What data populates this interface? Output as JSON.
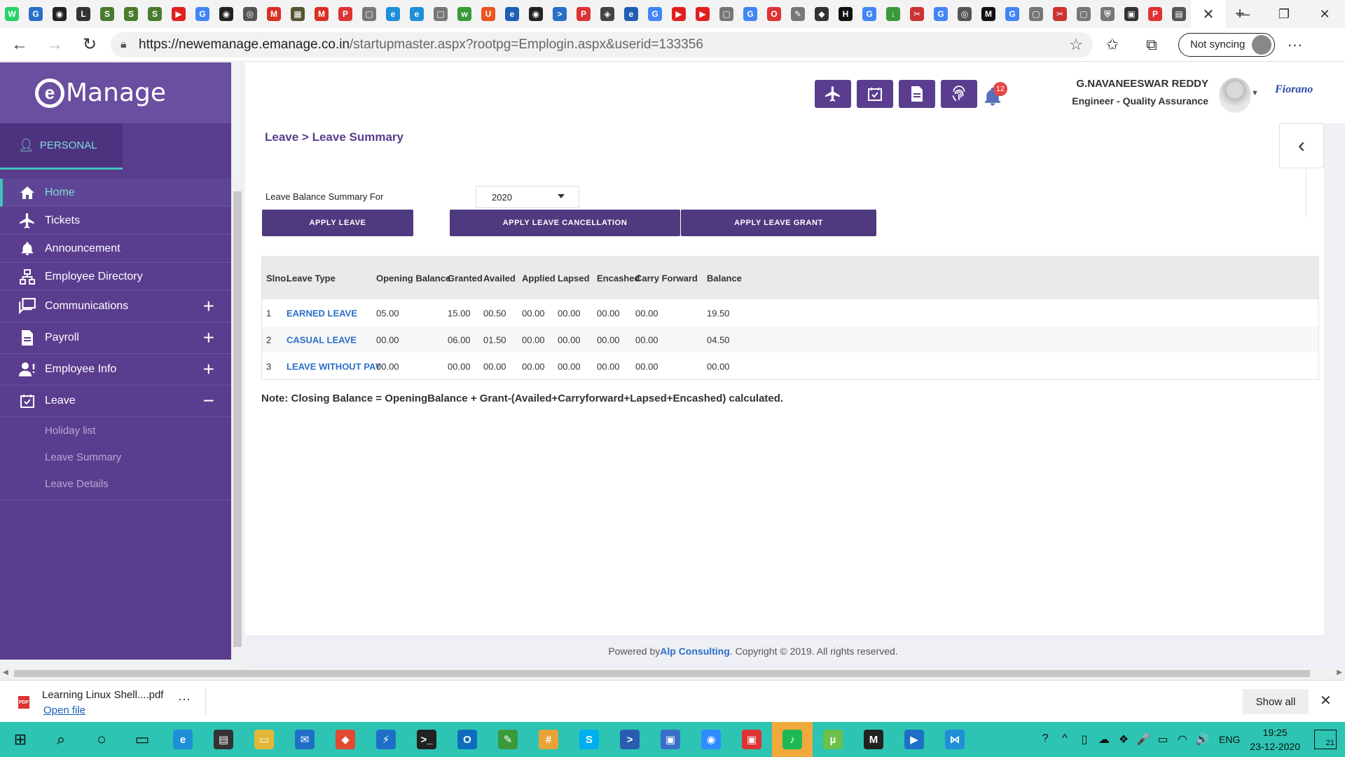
{
  "browser": {
    "tab_favicons": [
      {
        "icon": "whatsapp-icon",
        "glyph": "W",
        "color": "#25d366"
      },
      {
        "icon": "globe-icon",
        "glyph": "G",
        "color": "#2a6fc9"
      },
      {
        "icon": "github-icon",
        "glyph": "◉",
        "color": "#222"
      },
      {
        "icon": "linux-icon",
        "glyph": "L",
        "color": "#333"
      },
      {
        "icon": "sheets-icon",
        "glyph": "S",
        "color": "#4a7c2f"
      },
      {
        "icon": "sheets-icon",
        "glyph": "S",
        "color": "#4a7c2f"
      },
      {
        "icon": "sheets-icon",
        "glyph": "S",
        "color": "#4a7c2f"
      },
      {
        "icon": "youtube-icon",
        "glyph": "▶",
        "color": "#e02020"
      },
      {
        "icon": "google-icon",
        "glyph": "G",
        "color": "#4285f4"
      },
      {
        "icon": "github-icon",
        "glyph": "◉",
        "color": "#222"
      },
      {
        "icon": "globe-icon",
        "glyph": "◎",
        "color": "#555"
      },
      {
        "icon": "gmail-icon",
        "glyph": "M",
        "color": "#d93025"
      },
      {
        "icon": "image-icon",
        "glyph": "▦",
        "color": "#553"
      },
      {
        "icon": "gmail-icon",
        "glyph": "M",
        "color": "#d93025"
      },
      {
        "icon": "pdf-icon",
        "glyph": "P",
        "color": "#d33"
      },
      {
        "icon": "page-icon",
        "glyph": "▢",
        "color": "#777"
      },
      {
        "icon": "edge-icon",
        "glyph": "e",
        "color": "#1f8fd8"
      },
      {
        "icon": "edge-icon",
        "glyph": "e",
        "color": "#1f8fd8"
      },
      {
        "icon": "page-icon",
        "glyph": "▢",
        "color": "#777"
      },
      {
        "icon": "w3-icon",
        "glyph": "w",
        "color": "#3a9a3a"
      },
      {
        "icon": "ubuntu-icon",
        "glyph": "U",
        "color": "#e95420"
      },
      {
        "icon": "edureka-icon",
        "glyph": "e",
        "color": "#1f5fb4"
      },
      {
        "icon": "github-icon",
        "glyph": "◉",
        "color": "#222"
      },
      {
        "icon": "terminal-icon",
        "glyph": ">",
        "color": "#2a6fc9"
      },
      {
        "icon": "pdf-icon",
        "glyph": "P",
        "color": "#d33"
      },
      {
        "icon": "settings-icon",
        "glyph": "◈",
        "color": "#444"
      },
      {
        "icon": "edureka-icon",
        "glyph": "e",
        "color": "#1f5fb4"
      },
      {
        "icon": "google-icon",
        "glyph": "G",
        "color": "#4285f4"
      },
      {
        "icon": "youtube-icon",
        "glyph": "▶",
        "color": "#e02020"
      },
      {
        "icon": "youtube-icon",
        "glyph": "▶",
        "color": "#e02020"
      },
      {
        "icon": "page-icon",
        "glyph": "▢",
        "color": "#777"
      },
      {
        "icon": "google-icon",
        "glyph": "G",
        "color": "#4285f4"
      },
      {
        "icon": "os-icon",
        "glyph": "O",
        "color": "#d33"
      },
      {
        "icon": "tool-icon",
        "glyph": "✎",
        "color": "#777"
      },
      {
        "icon": "bookmark-icon",
        "glyph": "◆",
        "color": "#333"
      },
      {
        "icon": "hackernews-icon",
        "glyph": "H",
        "color": "#111"
      },
      {
        "icon": "google-icon",
        "glyph": "G",
        "color": "#4285f4"
      },
      {
        "icon": "download-icon",
        "glyph": "↓",
        "color": "#3a9a3a"
      },
      {
        "icon": "scissor-icon",
        "glyph": "✂",
        "color": "#c33"
      },
      {
        "icon": "google-icon",
        "glyph": "G",
        "color": "#4285f4"
      },
      {
        "icon": "circle-icon",
        "glyph": "◎",
        "color": "#555"
      },
      {
        "icon": "medium-icon",
        "glyph": "M",
        "color": "#111"
      },
      {
        "icon": "google-icon",
        "glyph": "G",
        "color": "#4285f4"
      },
      {
        "icon": "page-icon",
        "glyph": "▢",
        "color": "#777"
      },
      {
        "icon": "scissor-icon",
        "glyph": "✂",
        "color": "#c33"
      },
      {
        "icon": "page-icon",
        "glyph": "▢",
        "color": "#777"
      },
      {
        "icon": "shield-icon",
        "glyph": "⛨",
        "color": "#777"
      },
      {
        "icon": "app-icon",
        "glyph": "▣",
        "color": "#333"
      },
      {
        "icon": "pdf-icon",
        "glyph": "P",
        "color": "#d33"
      },
      {
        "icon": "grid-icon",
        "glyph": "▤",
        "color": "#555"
      }
    ],
    "active_tab_close": "✕",
    "new_tab": "+",
    "window_controls": [
      "—",
      "❐",
      "✕"
    ],
    "url_host": "https://newemanage.emanage.co.in",
    "url_path": "/startupmaster.aspx?rootpg=Emplogin.aspx&userid=133356",
    "sync_label": "Not syncing",
    "more_menu": "···"
  },
  "sidebar": {
    "logo_mark": "e",
    "logo_text": "Manage",
    "section_tab": "PERSONAL",
    "items": [
      {
        "label": "Home",
        "icon": "home-icon",
        "active": true,
        "expandable": false
      },
      {
        "label": "Tickets",
        "icon": "plane-icon",
        "active": false,
        "expandable": false
      },
      {
        "label": "Announcement",
        "icon": "bell-icon",
        "active": false,
        "expandable": false
      },
      {
        "label": "Employee Directory",
        "icon": "org-chart-icon",
        "active": false,
        "expandable": false
      },
      {
        "label": "Communications",
        "icon": "chat-icon",
        "active": false,
        "expandable": true,
        "toggle": "+"
      },
      {
        "label": "Payroll",
        "icon": "document-icon",
        "active": false,
        "expandable": true,
        "toggle": "+"
      },
      {
        "label": "Employee Info",
        "icon": "user-info-icon",
        "active": false,
        "expandable": true,
        "toggle": "+"
      },
      {
        "label": "Leave",
        "icon": "calendar-check-icon",
        "active": false,
        "expandable": true,
        "toggle": "−"
      }
    ],
    "leave_subitems": [
      "Holiday list",
      "Leave Summary",
      "Leave Details"
    ]
  },
  "header": {
    "notification_count": "12",
    "user_name": "G.NAVANEESWAR REDDY",
    "user_role": "Engineer - Quality Assurance",
    "org_logo_text": "Fiorano"
  },
  "page": {
    "breadcrumb": "Leave > Leave Summary",
    "summary_label": "Leave Balance Summary For",
    "year": "2020",
    "buttons": {
      "apply_leave": "APPLY LEAVE",
      "apply_cancellation": "APPLY LEAVE CANCELLATION",
      "apply_grant": "APPLY LEAVE GRANT"
    },
    "table": {
      "headers": [
        "Slno.",
        "Leave Type",
        "Opening Balance",
        "Granted",
        "Availed",
        "Applied",
        "Lapsed",
        "Encashed",
        "Carry Forward",
        "Balance"
      ],
      "rows": [
        [
          "1",
          "EARNED LEAVE",
          "05.00",
          "15.00",
          "00.50",
          "00.00",
          "00.00",
          "00.00",
          "00.00",
          "19.50"
        ],
        [
          "2",
          "CASUAL LEAVE",
          "00.00",
          "06.00",
          "01.50",
          "00.00",
          "00.00",
          "00.00",
          "00.00",
          "04.50"
        ],
        [
          "3",
          "LEAVE WITHOUT PAY",
          "00.00",
          "00.00",
          "00.00",
          "00.00",
          "00.00",
          "00.00",
          "00.00",
          "00.00"
        ]
      ]
    },
    "note": "Note: Closing Balance = OpeningBalance + Grant-(Availed+Carryforward+Lapsed+Encashed) calculated."
  },
  "footer": {
    "prefix": "Powered by ",
    "company": "Alp Consulting",
    "suffix": ". Copyright © 2019. All rights reserved."
  },
  "downloads": {
    "file_name": "Learning Linux Shell....pdf",
    "open_label": "Open file",
    "show_all": "Show all"
  },
  "taskbar": {
    "apps": [
      {
        "icon": "windows-start-icon",
        "glyph": "⊞",
        "color": "transparent",
        "plain": true
      },
      {
        "icon": "search-icon",
        "glyph": "⌕",
        "color": "transparent",
        "plain": true
      },
      {
        "icon": "cortana-icon",
        "glyph": "○",
        "color": "transparent",
        "plain": true
      },
      {
        "icon": "task-view-icon",
        "glyph": "▭",
        "color": "transparent",
        "plain": true
      },
      {
        "icon": "edge-icon",
        "glyph": "e",
        "color": "#1f8fd8"
      },
      {
        "icon": "store-icon",
        "glyph": "▤",
        "color": "#333"
      },
      {
        "icon": "file-explorer-icon",
        "glyph": "▭",
        "color": "#e2b73a"
      },
      {
        "icon": "mail-icon",
        "glyph": "✉",
        "color": "#1f6fc9"
      },
      {
        "icon": "git-icon",
        "glyph": "◆",
        "color": "#e04a32"
      },
      {
        "icon": "azure-icon",
        "glyph": "⚡",
        "color": "#1f6fc9"
      },
      {
        "icon": "terminal-icon",
        "glyph": ">_",
        "color": "#222"
      },
      {
        "icon": "outlook-icon",
        "glyph": "O",
        "color": "#0f6cbd"
      },
      {
        "icon": "paint-icon",
        "glyph": "✎",
        "color": "#3a9a3a"
      },
      {
        "icon": "slack-icon",
        "glyph": "#",
        "color": "#e8a33a"
      },
      {
        "icon": "skype-icon",
        "glyph": "S",
        "color": "#00aff0"
      },
      {
        "icon": "powershell-icon",
        "glyph": ">",
        "color": "#2a5db0"
      },
      {
        "icon": "remote-desktop-icon",
        "glyph": "▣",
        "color": "#3a6fc9"
      },
      {
        "icon": "zoom-icon",
        "glyph": "◉",
        "color": "#2d8cff"
      },
      {
        "icon": "toolbox-icon",
        "glyph": "▣",
        "color": "#d33"
      },
      {
        "icon": "spotify-icon",
        "glyph": "♪",
        "color": "#1db954",
        "active": true
      },
      {
        "icon": "utorrent-icon",
        "glyph": "µ",
        "color": "#6ac04a"
      },
      {
        "icon": "ide-icon",
        "glyph": "M",
        "color": "#222"
      },
      {
        "icon": "media-icon",
        "glyph": "▶",
        "color": "#1f6fc9"
      },
      {
        "icon": "vscode-icon",
        "glyph": "⋈",
        "color": "#1f8fd8"
      }
    ],
    "tray_icons": [
      "help-icon",
      "chevron-up-icon",
      "device-icon",
      "cloud-icon",
      "dropbox-icon",
      "mic-icon",
      "battery-icon",
      "wifi-icon",
      "volume-icon"
    ],
    "tray_glyphs": [
      "?",
      "^",
      "▯",
      "☁",
      "❖",
      "🎤",
      "▭",
      "◠",
      "🔊"
    ],
    "language": "ENG",
    "time": "19:25",
    "date": "23-12-2020",
    "notification_count": "21"
  }
}
